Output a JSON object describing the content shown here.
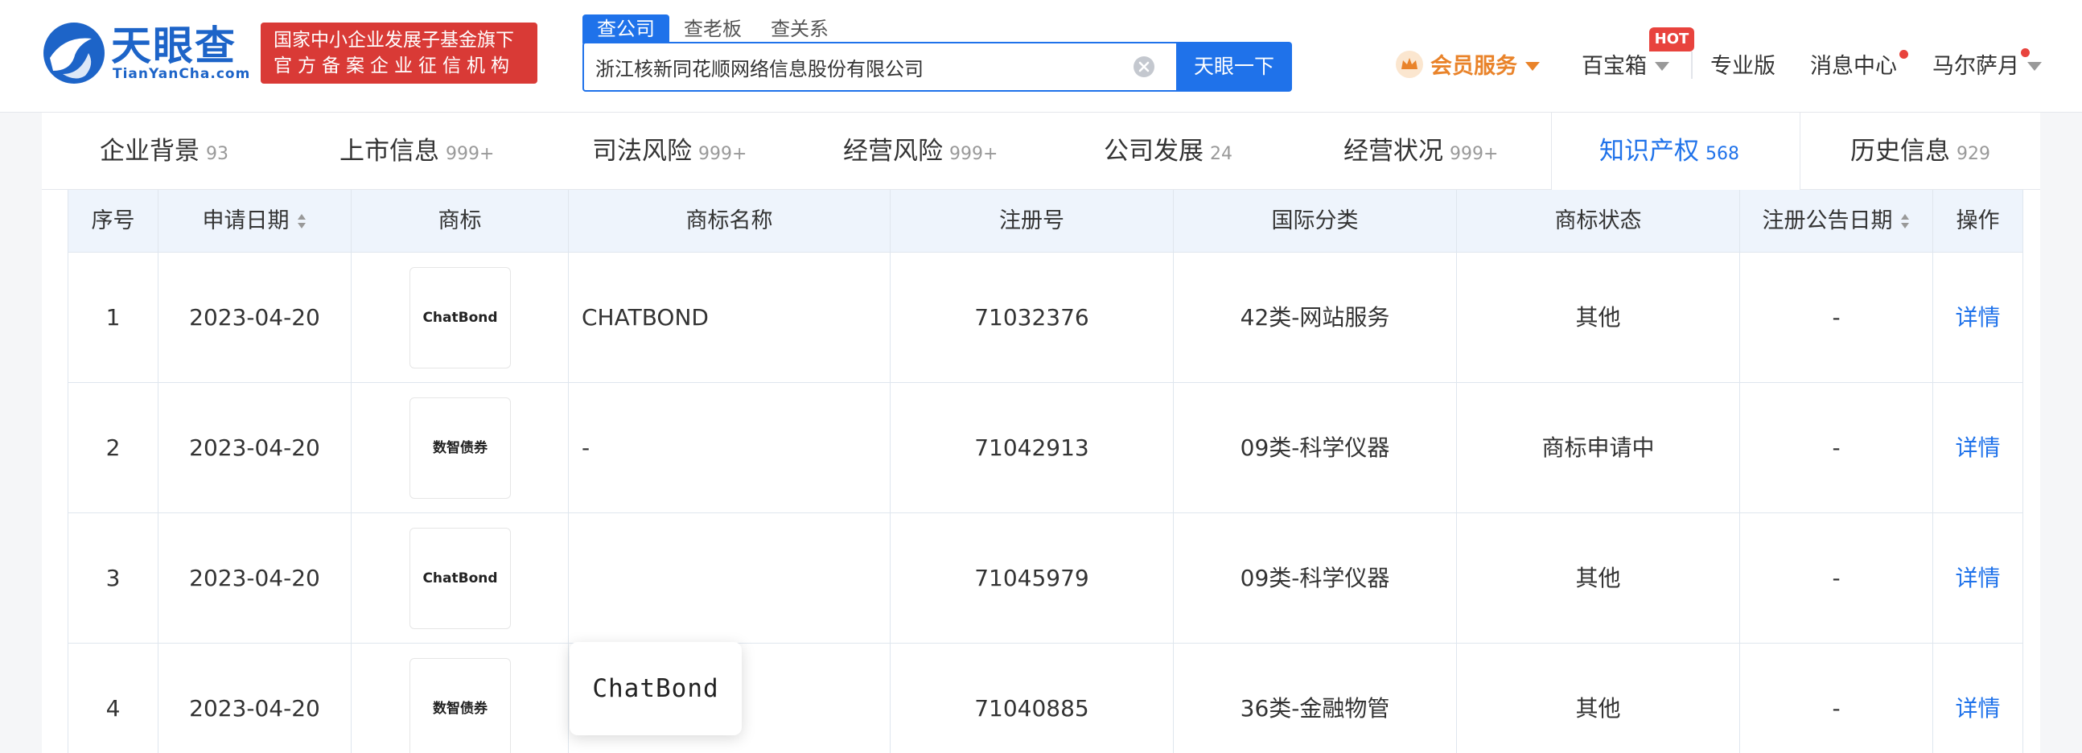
{
  "header": {
    "logo_text": "天眼查",
    "logo_sub": "TianYanCha.com",
    "gov_badge": [
      "国家中小企业发展子基金旗下",
      "官方备案企业征信机构"
    ],
    "search_tabs": [
      "查公司",
      "查老板",
      "查关系"
    ],
    "search_value": "浙江核新同花顺网络信息股份有限公司",
    "search_button": "天眼一下",
    "nav": {
      "vip": "会员服务",
      "toolbox": "百宝箱",
      "hot": "HOT",
      "pro": "专业版",
      "messages": "消息中心",
      "user": "马尔萨月"
    }
  },
  "tabs": [
    {
      "label": "企业背景",
      "count": "93"
    },
    {
      "label": "上市信息",
      "count": "999+"
    },
    {
      "label": "司法风险",
      "count": "999+"
    },
    {
      "label": "经营风险",
      "count": "999+"
    },
    {
      "label": "公司发展",
      "count": "24"
    },
    {
      "label": "经营状况",
      "count": "999+"
    },
    {
      "label": "知识产权",
      "count": "568"
    },
    {
      "label": "历史信息",
      "count": "929"
    }
  ],
  "active_tab": "知识产权",
  "table": {
    "headers": [
      "序号",
      "申请日期",
      "商标",
      "商标名称",
      "注册号",
      "国际分类",
      "商标状态",
      "注册公告日期",
      "操作"
    ],
    "rows": [
      {
        "no": "1",
        "date": "2023-04-20",
        "logo": "ChatBond",
        "name": "CHATBOND",
        "reg_no": "71032376",
        "class": "42类-网站服务",
        "status": "其他",
        "notice_date": "-",
        "action": "详情"
      },
      {
        "no": "2",
        "date": "2023-04-20",
        "logo": "数智债券",
        "name": "-",
        "reg_no": "71042913",
        "class": "09类-科学仪器",
        "status": "商标申请中",
        "notice_date": "-",
        "action": "详情"
      },
      {
        "no": "3",
        "date": "2023-04-20",
        "logo": "ChatBond",
        "name": "",
        "reg_no": "71045979",
        "class": "09类-科学仪器",
        "status": "其他",
        "notice_date": "-",
        "action": "详情"
      },
      {
        "no": "4",
        "date": "2023-04-20",
        "logo": "数智债券",
        "name": "-",
        "reg_no": "71040885",
        "class": "36类-金融物管",
        "status": "其他",
        "notice_date": "-",
        "action": "详情"
      }
    ]
  },
  "hover_preview": "ChatBond",
  "colors": {
    "brand": "#1f72ea",
    "badge_red": "#d93a36",
    "vip_orange": "#e9832a",
    "hot_red": "#e8433d"
  }
}
